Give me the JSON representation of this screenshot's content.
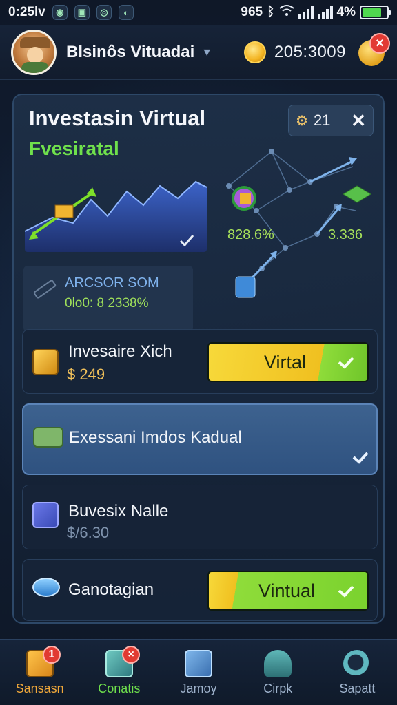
{
  "status_bar": {
    "time": "0:25lv",
    "network_text": "965",
    "battery_text": "4%"
  },
  "top_bar": {
    "title": "Blsinôs Vituadai",
    "coin_count": "205:3009",
    "notification_badge": "×"
  },
  "card": {
    "title": "Investasin Virtual",
    "subtitle": "Fvesiratal",
    "level_chip": "21",
    "net_label_left": "828.6%",
    "net_label_right": "3.336",
    "arcsor": {
      "title": "ARCSOR SOM",
      "value": "0lo0: 8 2338%"
    },
    "rows": [
      {
        "label": "Invesaire Xich",
        "price": "$ 249",
        "button": "Virtal"
      },
      {
        "label": "Exessani Imdos Kadual"
      },
      {
        "label": "Buvesix Nalle",
        "price": "$/6.30"
      },
      {
        "label": "Ganotagian",
        "button": "Vintual"
      }
    ]
  },
  "bottom_nav": [
    {
      "label": "Sansasn",
      "badge": "1",
      "color": "#e8a63a"
    },
    {
      "label": "Conatis",
      "badge": "×",
      "color": "#6fe04c"
    },
    {
      "label": "Jamoy",
      "color": "#9fb3cc"
    },
    {
      "label": "Cirpk",
      "color": "#6aa0d0"
    },
    {
      "label": "Sapatt",
      "color": "#7fb7e6"
    }
  ],
  "colors": {
    "accent_green": "#6fe04c",
    "accent_gold": "#f0c05a",
    "button_yellow": "#f4cf2a",
    "button_green": "#8fdc3a"
  }
}
